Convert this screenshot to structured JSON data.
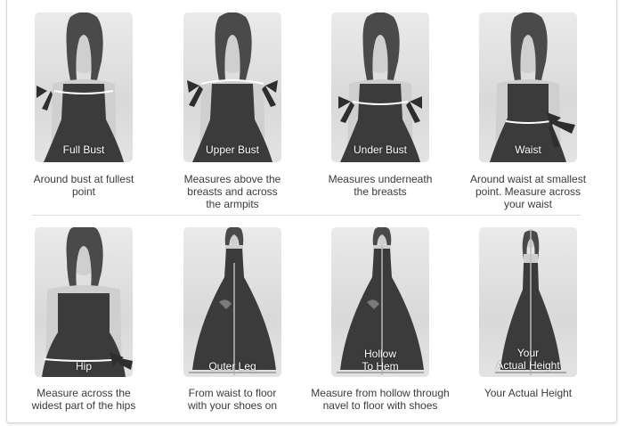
{
  "measurements": [
    {
      "label": "Full Bust",
      "description": [
        "Around bust at fullest",
        "point"
      ]
    },
    {
      "label": "Upper Bust",
      "description": [
        "Measures above the",
        "breasts and across",
        "the armpits"
      ]
    },
    {
      "label": "Under Bust",
      "description": [
        "Measures underneath",
        "the breasts"
      ]
    },
    {
      "label": "Waist",
      "description": [
        "Around waist at smallest",
        "point. Measure across",
        "your waist"
      ]
    },
    {
      "label": "Hip",
      "description": [
        "Measure across the",
        "widest part of the hips"
      ]
    },
    {
      "label": "Outer Leg",
      "description": [
        "From waist to floor",
        "with your shoes on"
      ]
    },
    {
      "label": [
        "Hollow",
        "To Hem"
      ],
      "description": [
        "Measure from hollow through",
        "navel to floor with shoes"
      ]
    },
    {
      "label": [
        "Your",
        "Actual Height"
      ],
      "description": [
        "Your Actual Height"
      ]
    }
  ],
  "colors": {
    "dress": "#3b3b3b",
    "hair": "#4a4a4a",
    "skin": "#cfcfcf",
    "tape": "#ffffff",
    "bow": "#2e2e2e",
    "text": "#3a3a3a"
  }
}
